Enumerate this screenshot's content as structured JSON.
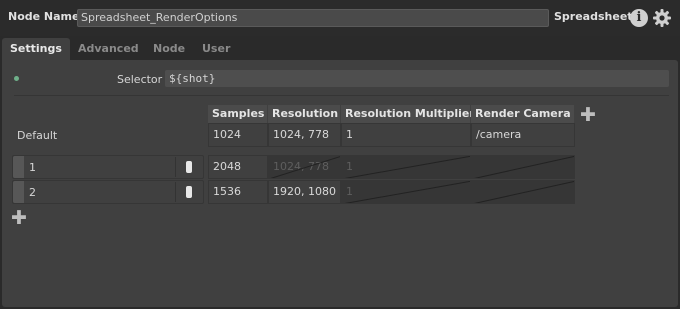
{
  "header": {
    "node_name_label": "Node Name",
    "node_name_value": "Spreadsheet_RenderOptions",
    "node_type": "Spreadsheet",
    "info_icon": "info-icon",
    "gear_icon": "gear-icon"
  },
  "tabs": [
    {
      "label": "Settings",
      "active": true
    },
    {
      "label": "Advanced",
      "active": false
    },
    {
      "label": "Node",
      "active": false
    },
    {
      "label": "User",
      "active": false
    }
  ],
  "selector": {
    "label": "Selector",
    "value": "${shot}"
  },
  "table": {
    "columns": [
      "Samples",
      "Resolution",
      "Resolution Multiplier",
      "Render Camera"
    ],
    "default_row": {
      "label": "Default",
      "values": [
        "1024",
        "1024, 778",
        "1",
        "/camera"
      ]
    },
    "rows": [
      {
        "label": "1",
        "values": [
          "2048",
          "1024, 778",
          "1",
          ""
        ]
      },
      {
        "label": "2",
        "values": [
          "1536",
          "1920, 1080",
          "1",
          ""
        ]
      }
    ]
  },
  "colors": {
    "status_dot": "#6fb08a",
    "panel": "#404040",
    "background": "#2a2a2a"
  }
}
